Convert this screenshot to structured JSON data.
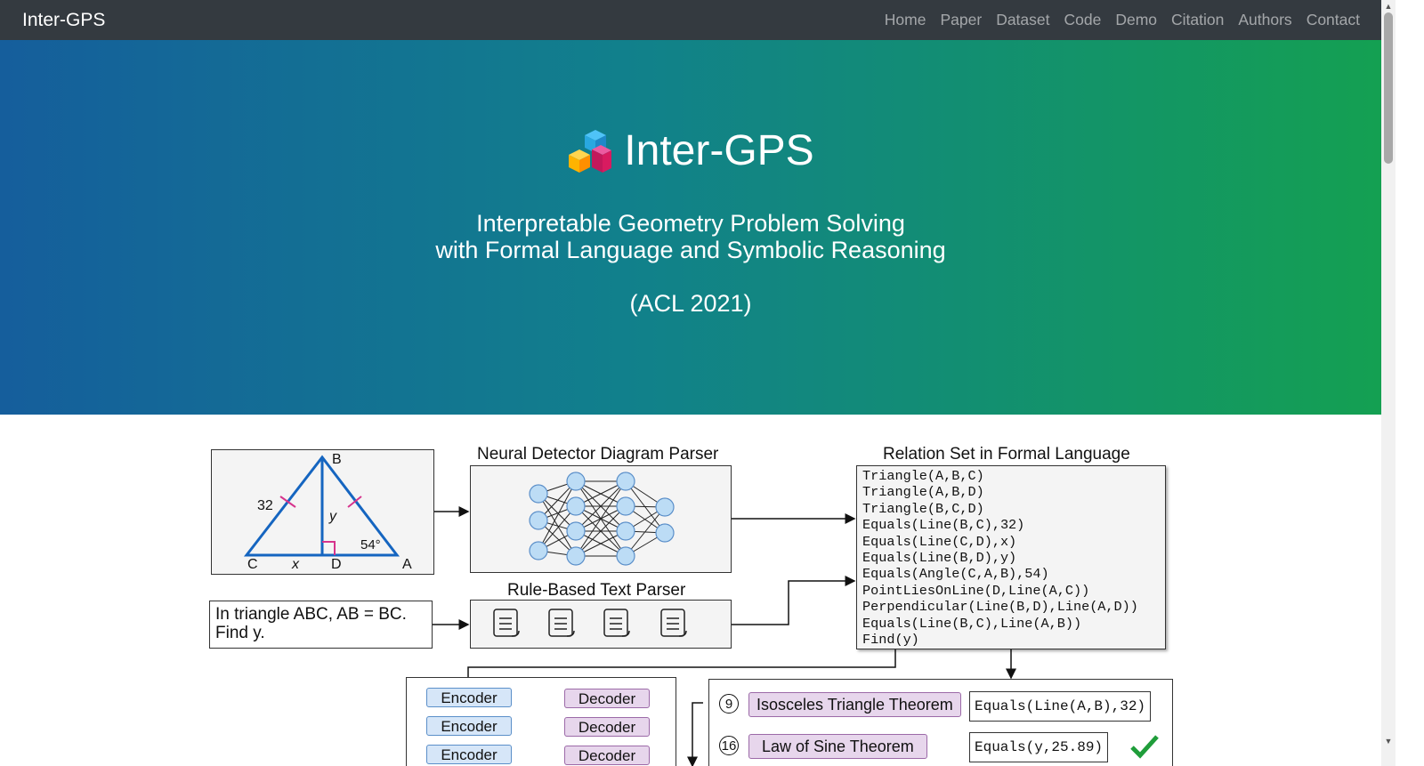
{
  "navbar": {
    "brand": "Inter-GPS",
    "links": [
      "Home",
      "Paper",
      "Dataset",
      "Code",
      "Demo",
      "Citation",
      "Authors",
      "Contact"
    ]
  },
  "hero": {
    "title": "Inter-GPS",
    "subtitle_line1": "Interpretable Geometry Problem Solving",
    "subtitle_line2": "with Formal Language and Symbolic Reasoning",
    "venue": "(ACL 2021)",
    "logo_icon": "cube-stack-icon",
    "gradient": [
      "#155e9c",
      "#14a052"
    ]
  },
  "figure": {
    "diagram_labels": {
      "B": "B",
      "C": "C",
      "D": "D",
      "A": "A",
      "side": "32",
      "height": "y",
      "base": "x",
      "angle": "54°"
    },
    "diagram_parser_title": "Neural Detector Diagram Parser",
    "text_parser_title": "Rule-Based Text Parser",
    "problem_text_line1": "In triangle ABC, AB = BC.",
    "problem_text_line2": "Find y.",
    "relation_title": "Relation Set in Formal Language",
    "relations": [
      "Triangle(A,B,C)",
      "Triangle(A,B,D)",
      "Triangle(B,C,D)",
      "Equals(Line(B,C),32)",
      "Equals(Line(C,D),x)",
      "Equals(Line(B,D),y)",
      "Equals(Angle(C,A,B),54)",
      "PointLiesOnLine(D,Line(A,C))",
      "Perpendicular(Line(B,D),Line(A,D))",
      "Equals(Line(B,C),Line(A,B))",
      "Find(y)"
    ],
    "encoder_label": "Encoder",
    "decoder_label": "Decoder",
    "steps": [
      {
        "num": "9",
        "theorem": "Isosceles Triangle Theorem",
        "result": "Equals(Line(A,B),32)"
      },
      {
        "num": "16",
        "theorem": "Law of Sine Theorem",
        "result": "Equals(y,25.89)"
      }
    ]
  }
}
